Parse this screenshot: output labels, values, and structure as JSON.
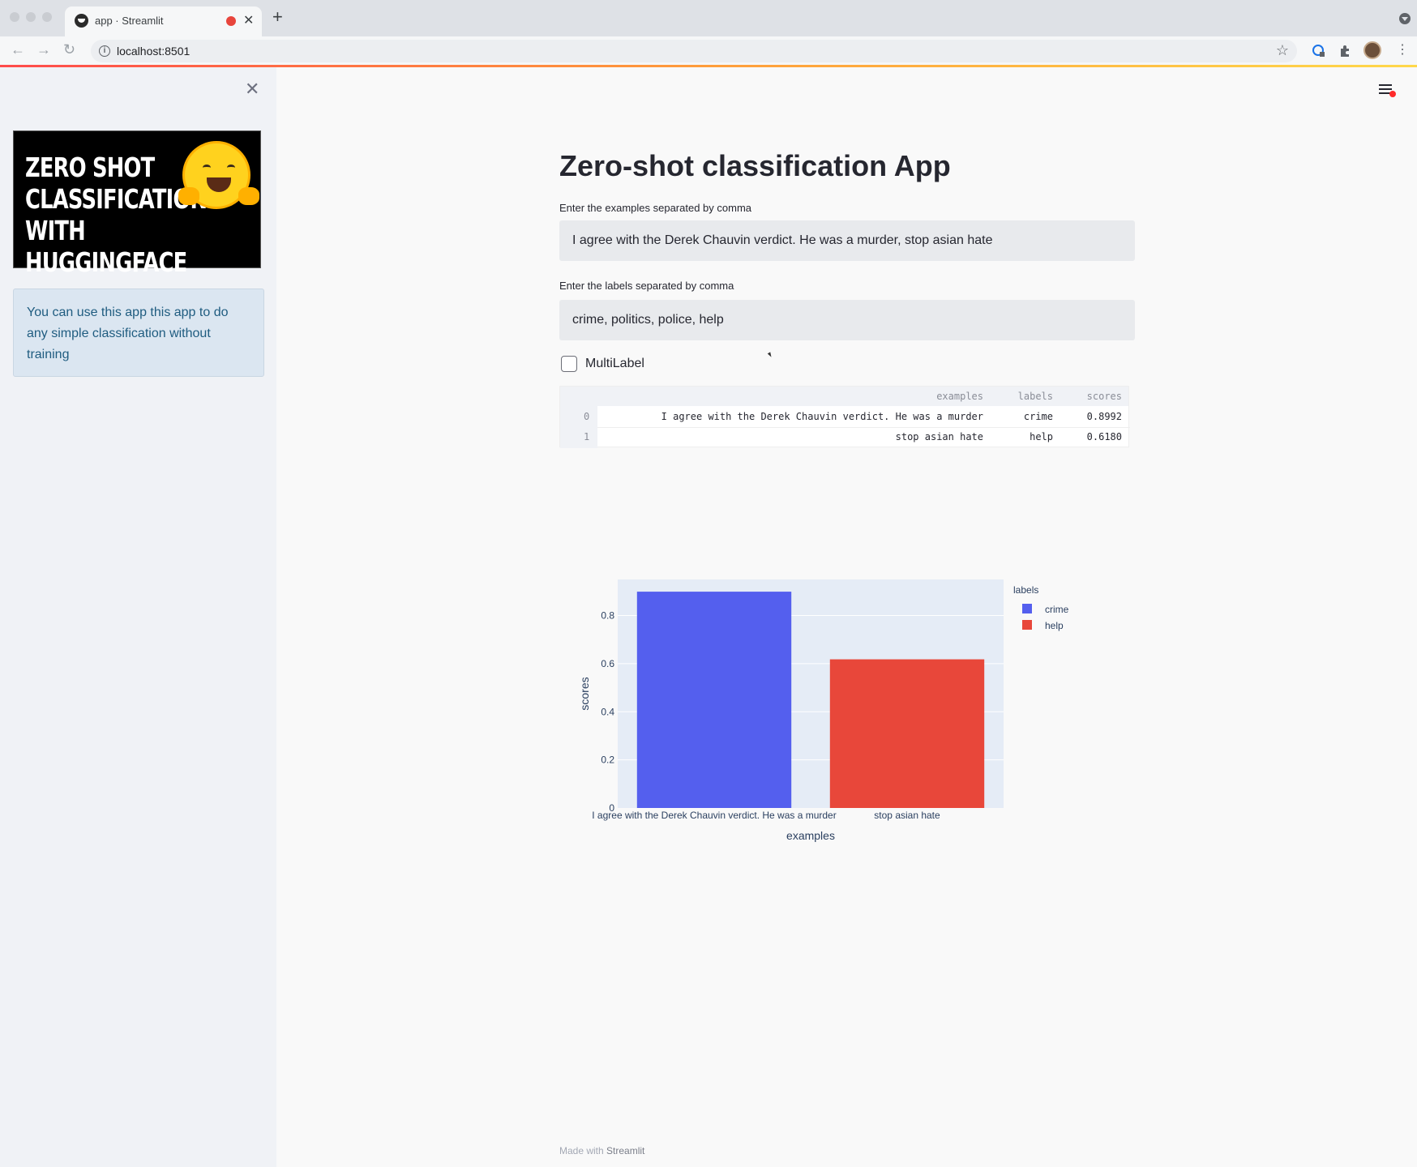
{
  "browser": {
    "tab_title": "app · Streamlit",
    "url": "localhost:8501"
  },
  "sidebar": {
    "banner_text": [
      "ZERO SHOT",
      "CLASSIFICATION",
      "WITH HUGGINGFACE"
    ],
    "info_text": "You can use this app this app to do any simple classification without training"
  },
  "main": {
    "title": "Zero-shot classification App",
    "examples_label": "Enter the examples separated by comma",
    "examples_value": "I agree with the Derek Chauvin verdict. He was a murder, stop asian hate",
    "labels_label": "Enter the labels separated by comma",
    "labels_value": "crime, politics, police, help",
    "multilabel_label": "MultiLabel",
    "multilabel_checked": false
  },
  "dataframe": {
    "columns": [
      "examples",
      "labels",
      "scores"
    ],
    "rows": [
      {
        "index": "0",
        "examples": "I agree with the Derek Chauvin verdict. He was a murder",
        "labels": "crime",
        "scores": "0.8992"
      },
      {
        "index": "1",
        "examples": "stop asian hate",
        "labels": "help",
        "scores": "0.6180"
      }
    ]
  },
  "chart_data": {
    "type": "bar",
    "categories": [
      "I agree with the Derek Chauvin verdict. He was a murder",
      "stop asian hate"
    ],
    "series": [
      {
        "name": "crime",
        "values": [
          0.8992,
          null
        ],
        "color": "#545fee"
      },
      {
        "name": "help",
        "values": [
          null,
          0.618
        ],
        "color": "#e8473a"
      }
    ],
    "xlabel": "examples",
    "ylabel": "scores",
    "ylim": [
      0,
      0.95
    ],
    "yticks": [
      "0",
      "0.2",
      "0.4",
      "0.6",
      "0.8"
    ],
    "legend_title": "labels",
    "legend_position": "right",
    "grid": true
  },
  "footer": {
    "prefix": "Made with",
    "brand": "Streamlit"
  }
}
